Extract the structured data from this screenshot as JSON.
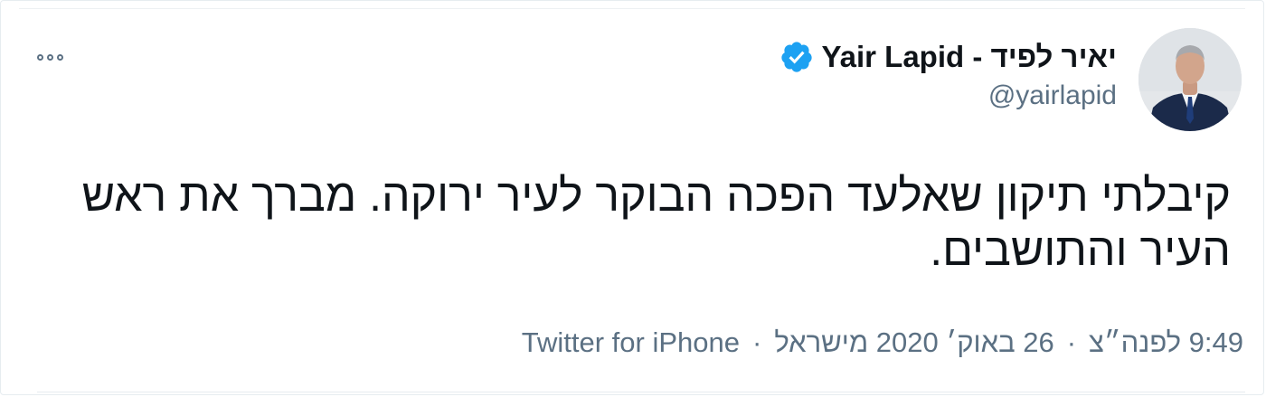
{
  "tweet": {
    "display_name": "Yair Lapid - יאיר לפיד",
    "handle": "@yairlapid",
    "verified_icon": "verified-badge-icon",
    "more_icon": "more-options-icon",
    "text": "קיבלתי תיקון שאלעד הפכה הבוקר לעיר ירוקה. מברך את ראש העיר והתושבים.",
    "time": "9:49 לפנה״צ",
    "separator": "·",
    "date": "26 באוק׳ 2020 מישראל",
    "source": "Twitter for iPhone",
    "colors": {
      "verified": "#1da1f2",
      "secondary_text": "#5b7083",
      "primary_text": "#0f1419"
    }
  }
}
